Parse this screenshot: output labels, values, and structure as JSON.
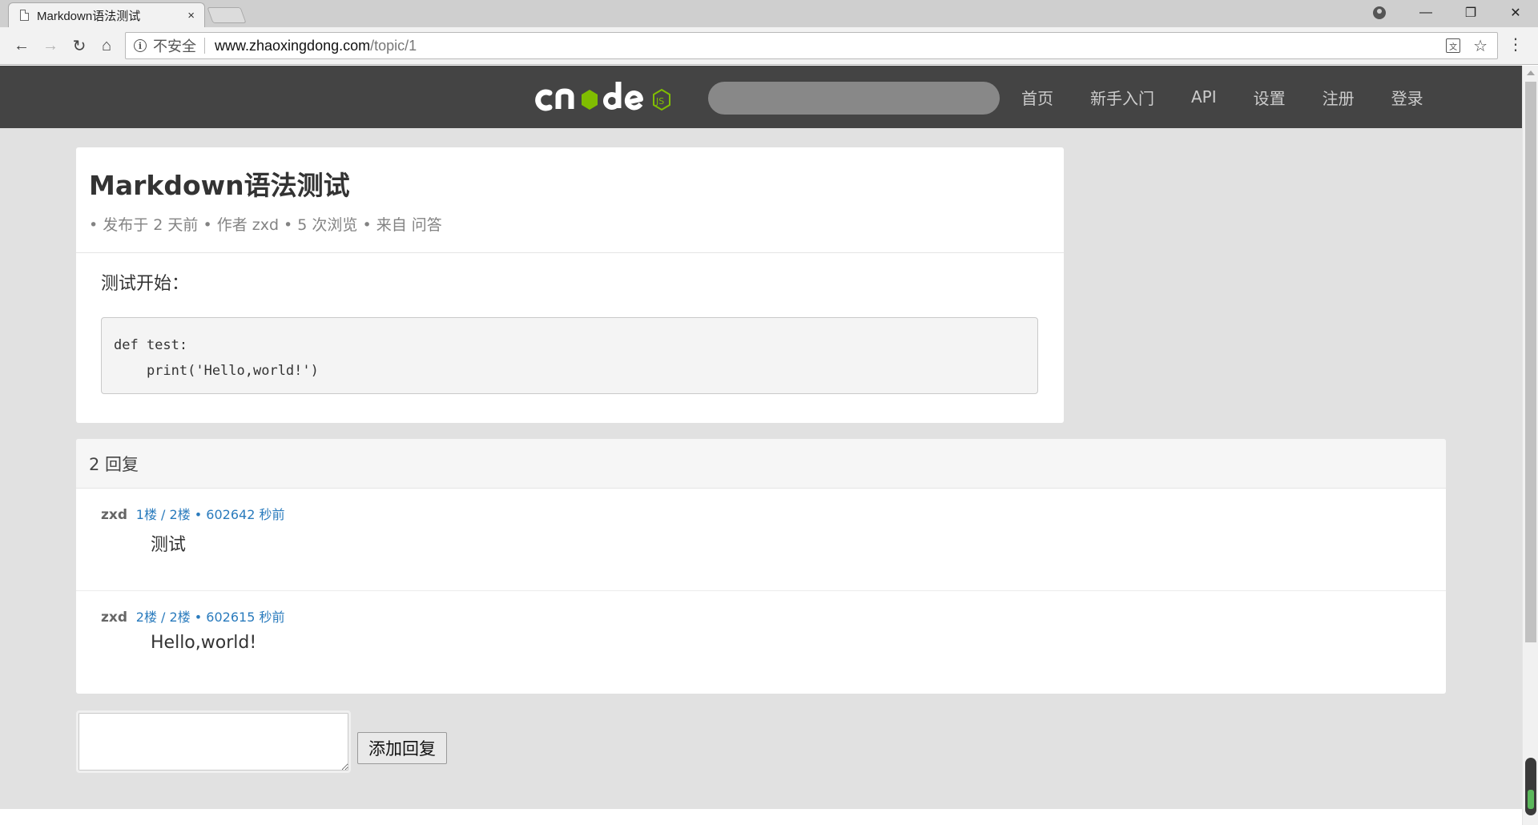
{
  "browser": {
    "tab_title": "Markdown语法测试",
    "tab_close": "×",
    "security_label": "不安全",
    "url_host": "www.zhaoxingdong.com",
    "url_path": "/topic/1",
    "back_glyph": "←",
    "forward_glyph": "→",
    "reload_glyph": "↻",
    "home_glyph": "⌂",
    "star_glyph": "☆",
    "menu_glyph": "⋮",
    "minimize_glyph": "—",
    "maximize_glyph": "❐",
    "close_glyph": "✕",
    "icons": [
      "page-icon",
      "info-icon",
      "translate-icon",
      "star-icon",
      "menu-icon",
      "profile-icon"
    ]
  },
  "site": {
    "nav": [
      "首页",
      "新手入门",
      "API",
      "设置",
      "注册",
      "登录"
    ],
    "header_bg": "#444444",
    "logo_accent": "#80bd01"
  },
  "topic": {
    "title": "Markdown语法测试",
    "meta": "• 发布于 2 天前 • 作者 zxd • 5 次浏览 • 来自 问答",
    "intro": "测试开始：",
    "code": "def test:\n    print('Hello,world!')"
  },
  "replies": {
    "header": "2 回复",
    "items": [
      {
        "author": "zxd",
        "floor": "1楼 / 2楼 • 602642 秒前",
        "content": "测试"
      },
      {
        "author": "zxd",
        "floor": "2楼 / 2楼 • 602615 秒前",
        "content": "Hello,world!"
      }
    ]
  },
  "reply_form": {
    "textarea_value": "",
    "submit_label": "添加回复"
  },
  "colors": {
    "link": "#2a7bbd",
    "page_bg": "#e1e1e1"
  }
}
